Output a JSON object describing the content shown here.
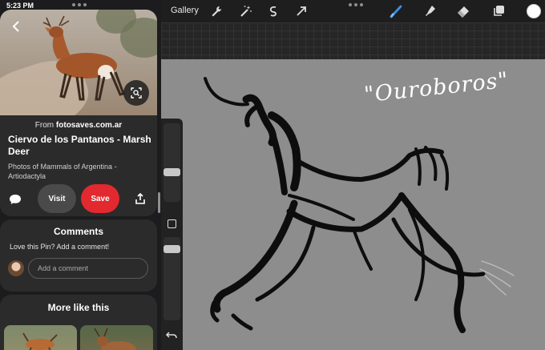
{
  "status_bar": {
    "time": "5:23 PM"
  },
  "pin": {
    "source_prefix": "From",
    "source_domain": "fotosaves.com.ar",
    "title": "Ciervo de los Pantanos - Marsh Deer",
    "subtitle": "Photos of Mammals of Argentina - Artiodactyla",
    "visit_label": "Visit",
    "save_label": "Save"
  },
  "comments": {
    "title": "Comments",
    "prompt": "Love this Pin? Add a comment!",
    "input_placeholder": "Add a comment"
  },
  "more": {
    "title": "More like this"
  },
  "procreate": {
    "gallery_label": "Gallery",
    "canvas_text": "\"Ouroboros\"",
    "toolbar_icons": [
      "wrench-icon",
      "magic-wand-icon",
      "selection-icon",
      "transform-arrow-icon",
      "brush-icon",
      "smudge-icon",
      "eraser-icon",
      "layers-icon"
    ],
    "current_color": "#ffffff"
  },
  "colors": {
    "save_red": "#e1292f",
    "canvas_gray": "#8d8d8d"
  }
}
